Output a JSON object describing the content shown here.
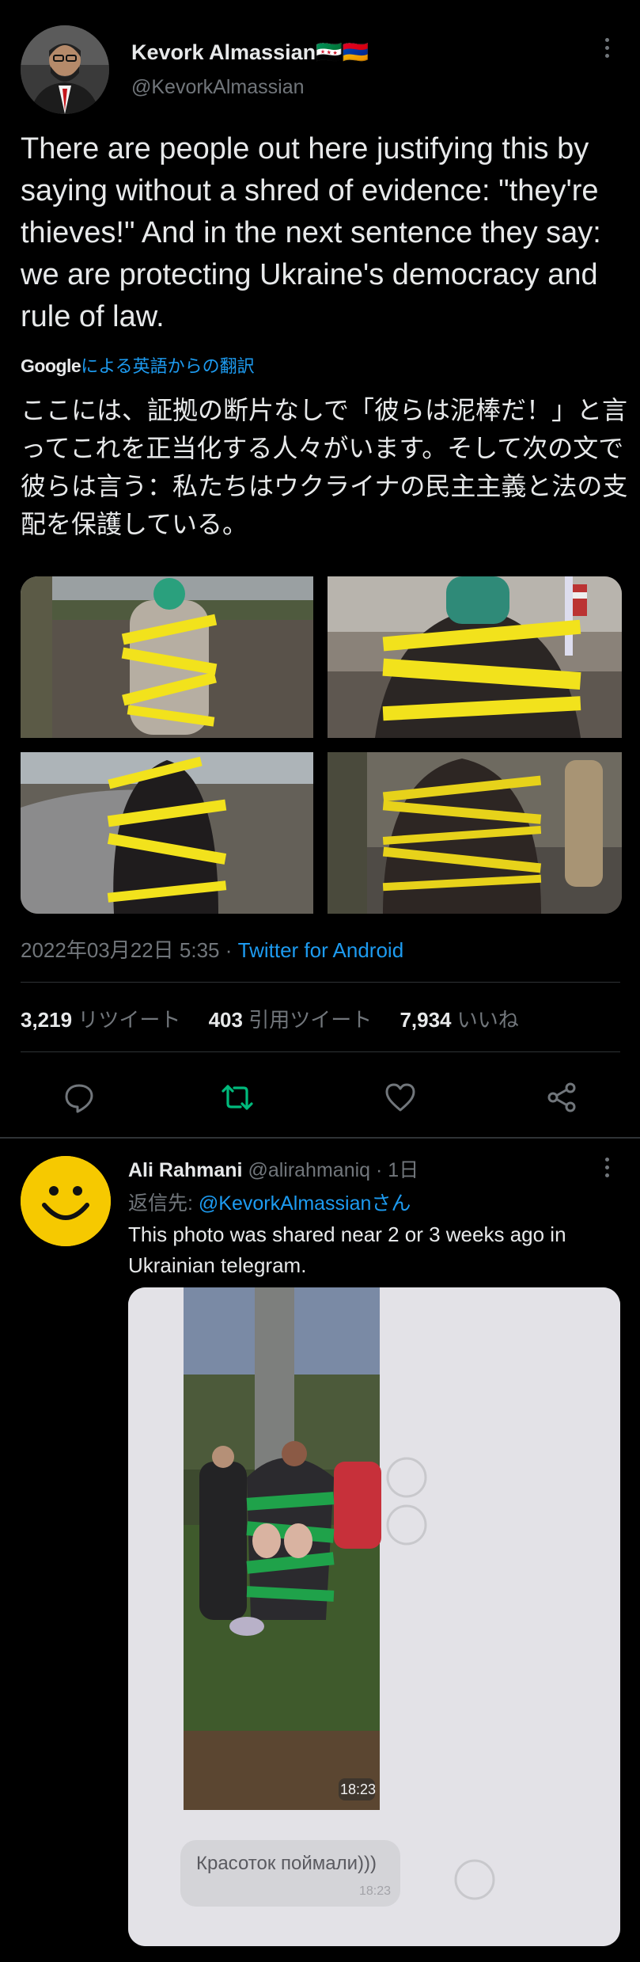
{
  "tweet": {
    "author_name": "Kevork Almassian🇸🇾🇦🇲",
    "author_handle": "@KevorkAlmassian",
    "text": "There are people out here justifying this by saying without a shred of evidence: \"they're thieves!\" And in the next sentence they say: we are protecting Ukraine's democracy and rule of law.",
    "translate_logo": "Google",
    "translate_label": "による英語からの翻訳",
    "translated_text": "ここには、証拠の断片なしで「彼らは泥棒だ！」と言ってこれを正当化する人々がいます。そして次の文で彼らは言う：私たちはウクライナの民主主義と法の支配を保護している。",
    "timestamp": "2022年03月22日 5:35",
    "separator": " · ",
    "client": "Twitter for Android",
    "retweets": "3,219",
    "retweets_label": "リツイート",
    "quotes": "403",
    "quotes_label": "引用ツイート",
    "likes": "7,934",
    "likes_label": "いいね"
  },
  "actions": {
    "reply_icon": "reply-icon",
    "retweet_icon": "retweet-icon",
    "like_icon": "heart-icon",
    "share_icon": "share-icon",
    "retweet_color": "#00ba7c",
    "muted_color": "#71767b"
  },
  "reply": {
    "author_name": "Ali Rahmani",
    "author_handle": "@alirahmaniq",
    "time": "· 1日",
    "reply_to_label": "返信先: ",
    "reply_to_handle": "@KevorkAlmassianさん",
    "text": "This photo was shared near 2 or 3 weeks ago in Ukrainian telegram.",
    "embedded_time": "18:23",
    "embedded_message": "Красоток поймали)))",
    "embedded_message_time": "18:23"
  },
  "colors": {
    "background": "#000000",
    "text": "#e7e9ea",
    "muted": "#71767b",
    "link": "#1d9bf0",
    "divider": "#2f3336",
    "tape_yellow": "#f2e21c",
    "tape_green": "#1fa24a"
  }
}
